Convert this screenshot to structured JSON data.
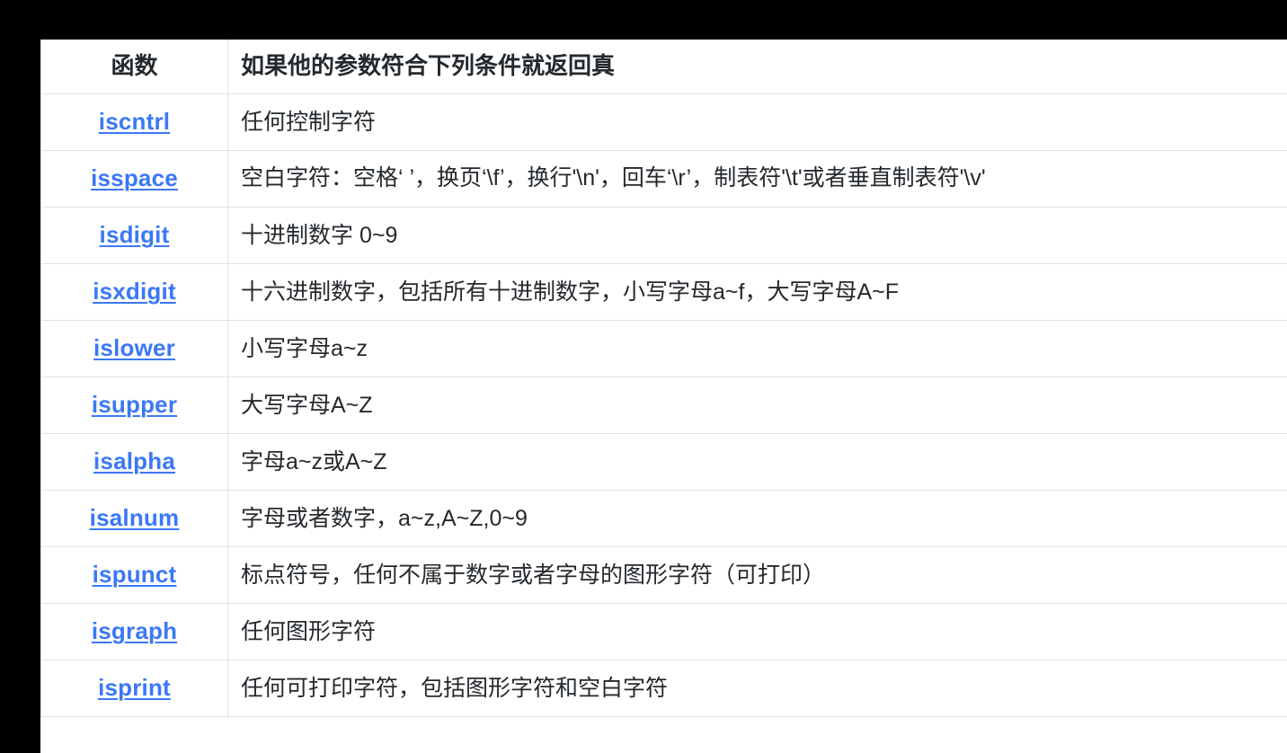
{
  "page": {
    "background_color": "#000000",
    "panel_color": "#ffffff",
    "border_color": "#dfe2e5",
    "link_color": "#3b78f7",
    "text_color": "#24292e"
  },
  "table": {
    "headers": {
      "function": "函数",
      "description": "如果他的参数符合下列条件就返回真"
    },
    "rows": [
      {
        "function": "iscntrl",
        "description": "任何控制字符",
        "tall": false
      },
      {
        "function": "isspace",
        "description": "空白字符：空格‘ ’，换页‘\\f’，换行'\\n'，回车‘\\r’，制表符'\\t'或者垂直制表符'\\v'",
        "tall": true
      },
      {
        "function": "isdigit",
        "description": "十进制数字 0~9",
        "tall": false
      },
      {
        "function": "isxdigit",
        "description": "十六进制数字，包括所有十进制数字，小写字母a~f，大写字母A~F",
        "tall": false
      },
      {
        "function": "islower",
        "description": "小写字母a~z",
        "tall": false
      },
      {
        "function": "isupper",
        "description": "大写字母A~Z",
        "tall": false
      },
      {
        "function": "isalpha",
        "description": "字母a~z或A~Z",
        "tall": false
      },
      {
        "function": "isalnum",
        "description": "字母或者数字，a~z,A~Z,0~9",
        "tall": false
      },
      {
        "function": "ispunct",
        "description": "标点符号，任何不属于数字或者字母的图形字符（可打印）",
        "tall": false
      },
      {
        "function": "isgraph",
        "description": "任何图形字符",
        "tall": false
      },
      {
        "function": "isprint",
        "description": "任何可打印字符，包括图形字符和空白字符",
        "tall": false
      }
    ]
  }
}
